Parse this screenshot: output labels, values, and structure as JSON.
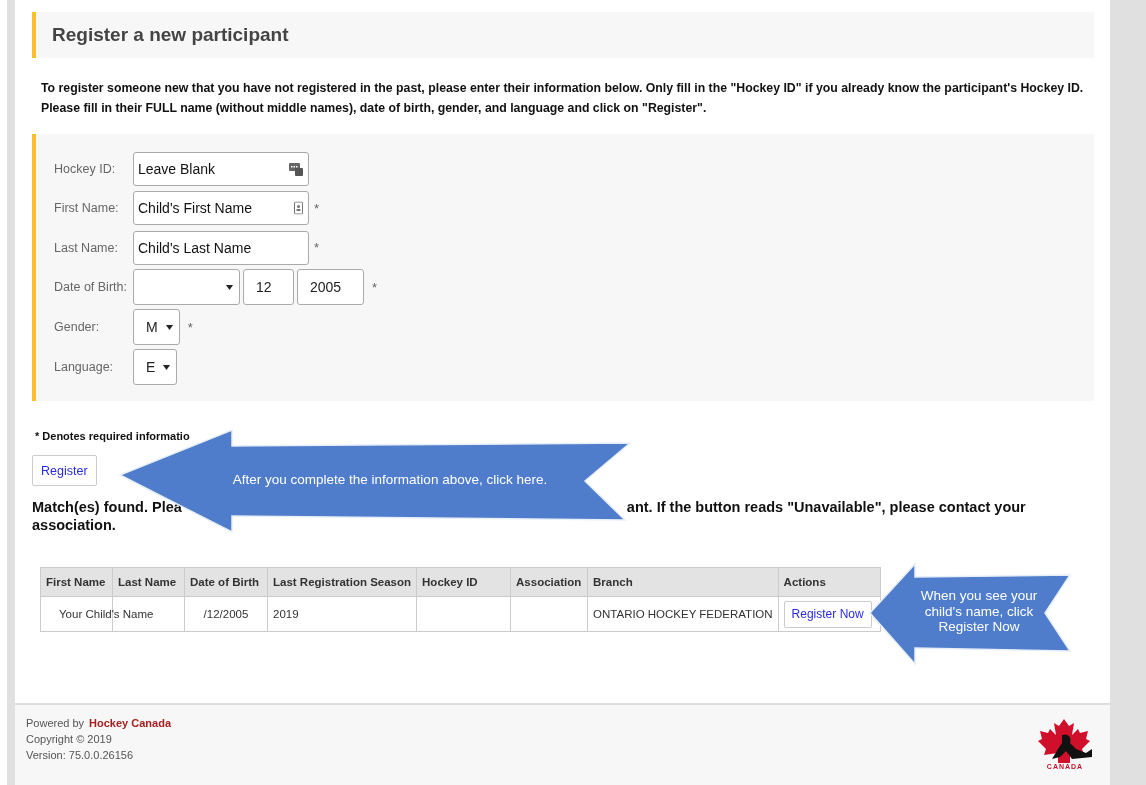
{
  "header": {
    "title": "Register a new participant"
  },
  "instructions": "To register someone new that you have not registered in the past, please enter their information below. Only fill in the \"Hockey ID\" if you already know the participant's Hockey ID. Please fill in their FULL name (without middle names), date of birth, gender, and language and click on \"Register\".",
  "form": {
    "fields": [
      {
        "kind": "id-text",
        "label": "Hockey ID:",
        "value": "Leave Blank"
      },
      {
        "kind": "contact-text",
        "label": "First Name:",
        "value": "Child's First Name",
        "required_mark": "*"
      },
      {
        "kind": "text",
        "label": "Last Name:",
        "value": "Child's Last Name",
        "required_mark": "*"
      },
      {
        "kind": "date",
        "label": "Date of Birth:",
        "parts": [
          {
            "kind": "day"
          },
          {
            "kind": "month",
            "value": "12"
          },
          {
            "kind": "year",
            "value": "2005"
          }
        ],
        "required_mark": "*"
      },
      {
        "kind": "select",
        "label": "Gender:",
        "value": "M",
        "required_mark": "*"
      },
      {
        "kind": "select",
        "label": "Language:",
        "value": "E"
      }
    ]
  },
  "required_note": "* Denotes required informatio",
  "register_button": "Register",
  "matches_text": [
    "Match(es) found. Plea",
    "ant. If the button reads \"Unavailable\", please contact your",
    "association."
  ],
  "table": {
    "columns": [
      "First Name",
      "Last Name",
      "Date of Birth",
      "Last Registration Season",
      "Hockey ID",
      "Association",
      "Branch",
      "Actions"
    ],
    "rows": [
      {
        "cells": [
          {
            "kind": "wide",
            "text": "Your Child's Name"
          },
          {
            "kind": "blank"
          },
          {
            "kind": "center",
            "text": "/12/2005"
          },
          {
            "kind": "cell",
            "text": "2019"
          },
          {
            "kind": "blank"
          },
          {
            "kind": "blank"
          },
          {
            "kind": "cell",
            "text": "ONTARIO HOCKEY FEDERATION"
          },
          {
            "kind": "button",
            "text": "Register Now"
          }
        ]
      }
    ]
  },
  "callouts": [
    {
      "text": "After you complete the information above, click here."
    },
    {
      "text": "When you see your child's name, click Register Now"
    }
  ],
  "footer": {
    "powered_by": "Powered by",
    "brand": "Hockey Canada",
    "copyright": "Copyright © 2019",
    "version": "Version: 75.0.0.26156",
    "logo_text": "CANADA"
  }
}
